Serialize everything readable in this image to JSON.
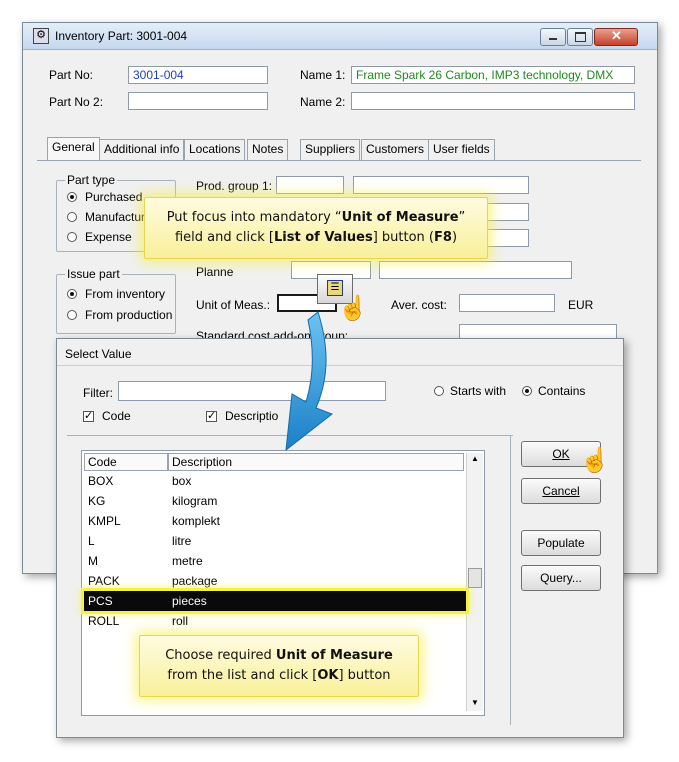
{
  "window": {
    "title": "Inventory Part: 3001-004",
    "part_no_label": "Part No:",
    "part_no_value": "3001-004",
    "part_no2_label": "Part No 2:",
    "name1_label": "Name 1:",
    "name1_value": "Frame Spark 26 Carbon, IMP3 technology, DMX",
    "name2_label": "Name 2:",
    "tabs": [
      "General",
      "Additional info",
      "Locations",
      "Notes",
      "Suppliers",
      "Customers",
      "User fields"
    ],
    "part_type": {
      "label": "Part type",
      "options": [
        "Purchased",
        "Manufactur",
        "Expense"
      ],
      "selected": 0
    },
    "issue_part": {
      "label": "Issue part",
      "options": [
        "From inventory",
        "From production"
      ],
      "selected": 0
    },
    "prod_group_label": "Prod. group 1:",
    "planner_label": "Planne",
    "unit_of_meas_label": "Unit of Meas.:",
    "aver_cost_label": "Aver. cost:",
    "currency": "EUR",
    "std_cost_label": "Standard cost add-on group:"
  },
  "dialog": {
    "title": "Select Value",
    "filter_label": "Filter:",
    "starts_with_label": "Starts with",
    "contains_label": "Contains",
    "code_chk_label": "Code",
    "desc_chk_label": "Descriptio",
    "columns": [
      "Code",
      "Description"
    ],
    "rows": [
      {
        "code": "BOX",
        "desc": "box"
      },
      {
        "code": "KG",
        "desc": "kilogram"
      },
      {
        "code": "KMPL",
        "desc": "komplekt"
      },
      {
        "code": "L",
        "desc": "litre"
      },
      {
        "code": "M",
        "desc": "metre"
      },
      {
        "code": "PACK",
        "desc": "package"
      },
      {
        "code": "PCS",
        "desc": "pieces"
      },
      {
        "code": "ROLL",
        "desc": "roll"
      }
    ],
    "selected_code": "PCS",
    "buttons": {
      "ok_label": "OK",
      "cancel_label": "Cancel",
      "populate_label": "Populate",
      "query_label": "Query..."
    }
  },
  "callouts": {
    "top_line1_a": "Put focus into mandatory “",
    "top_line1_b": "Unit of Measure",
    "top_line1_c": "”",
    "top_line2_a": "field and click [",
    "top_line2_b": "List of Values",
    "top_line2_c": "] button (",
    "top_line2_d": "F8",
    "top_line2_e": ")",
    "bottom_line1_a": "Choose required ",
    "bottom_line1_b": "Unit of Measure",
    "bottom_line2_a": "from the list and click [",
    "bottom_line2_b": "OK",
    "bottom_line2_c": "] button"
  },
  "colors": {
    "part_no_text": "#1f3fbf",
    "name1_text": "#1f8a1f",
    "callout_glow": "#f6f046",
    "selected_row_bg": "#0a0a0a",
    "arrow": "#2a9bd8"
  }
}
